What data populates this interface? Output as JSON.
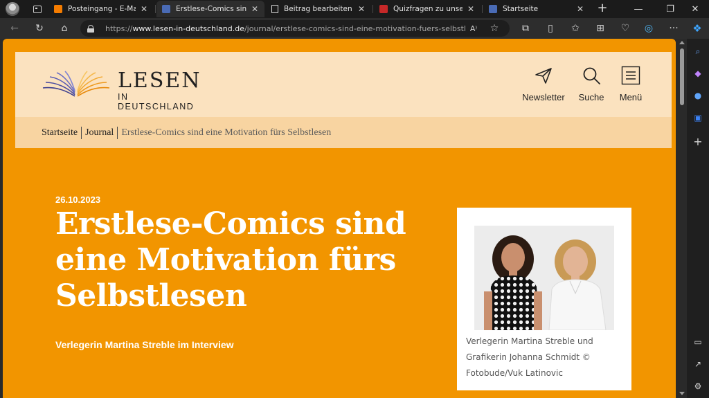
{
  "browser": {
    "tabs": [
      {
        "title": "Posteingang - E-Mail - S",
        "favicon_color": "#f57c00",
        "active": false
      },
      {
        "title": "Erstlese-Comics sind ein",
        "favicon_color": "#4a6bb5",
        "active": true
      },
      {
        "title": "Beitrag bearbeiten „Lese",
        "favicon_color": "#e0e0e0",
        "active": false
      },
      {
        "title": "Quizfragen zu unseren H",
        "favicon_color": "#c62828",
        "active": false
      },
      {
        "title": "Startseite",
        "favicon_color": "#4a6bb5",
        "active": false
      }
    ],
    "url_prefix": "https://",
    "url_domain": "www.lesen-in-deutschland.de",
    "url_path": "/journal/erstlese-comics-sind-eine-motivation-fuers-selbstlesen-..."
  },
  "site": {
    "logo_word": "LESEN",
    "logo_sub": "IN DEUTSCHLAND",
    "nav": {
      "newsletter": "Newsletter",
      "search": "Suche",
      "menu": "Menü"
    },
    "breadcrumb": [
      "Startseite",
      "Journal",
      "Erstlese-Comics sind eine Motivation fürs Selbstlesen"
    ]
  },
  "article": {
    "date": "26.10.2023",
    "headline_lines": [
      "Erstlese-Comics sind",
      "eine Motivation fürs",
      "Selbstlesen"
    ],
    "subline": "Verlegerin Martina Streble im Interview",
    "caption_lines": [
      "Verlegerin Martina Streble und",
      "Grafikerin Johanna Schmidt ©",
      "Fotobude/Vuk Latinovic"
    ]
  },
  "colors": {
    "page_bg": "#f29500",
    "header_bg": "#fbe2bf",
    "breadcrumb_bg": "#f8d4a1"
  }
}
